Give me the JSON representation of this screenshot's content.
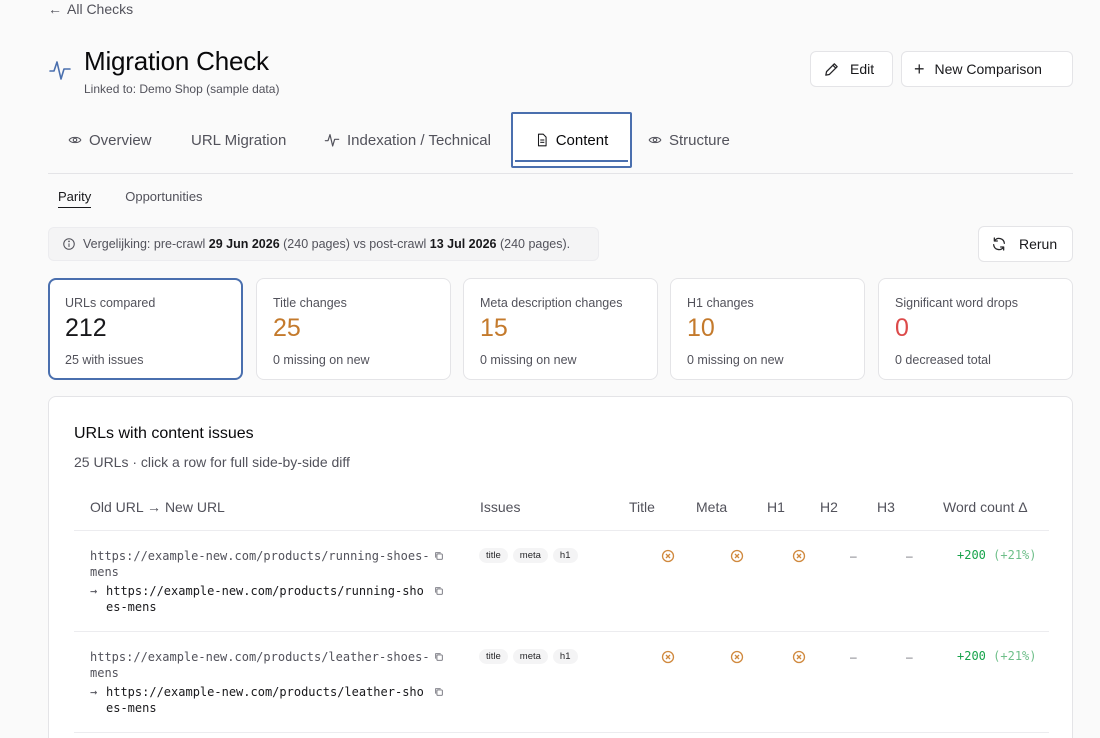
{
  "nav": {
    "back_label": "All Checks"
  },
  "header": {
    "title": "Migration Check",
    "linked": "Linked to: Demo Shop (sample data)",
    "edit_label": "Edit",
    "new_comparison_label": "New Comparison"
  },
  "tabs": [
    {
      "label": "Overview",
      "icon": "eye-icon"
    },
    {
      "label": "URL Migration",
      "icon": ""
    },
    {
      "label": "Indexation / Technical",
      "icon": "activity-icon"
    },
    {
      "label": "Content",
      "icon": "document-icon",
      "active": true
    },
    {
      "label": "Structure",
      "icon": "eye-icon"
    }
  ],
  "subtabs": [
    {
      "label": "Parity",
      "active": true
    },
    {
      "label": "Opportunities"
    }
  ],
  "info": {
    "prefix": "Vergelijking: pre-crawl",
    "pre_date": "29 Jun 2026",
    "pre_pages": "(240 pages) vs post-crawl",
    "post_date": "13 Jul 2026",
    "post_pages": "(240 pages)."
  },
  "rerun_label": "Rerun",
  "cards": [
    {
      "label": "URLs compared",
      "value": "212",
      "note": "25 with issues",
      "color": "#18181b"
    },
    {
      "label": "Title changes",
      "value": "25",
      "note": "0 missing on new",
      "color": "#c47a2c"
    },
    {
      "label": "Meta description changes",
      "value": "15",
      "note": "0 missing on new",
      "color": "#c47a2c"
    },
    {
      "label": "H1 changes",
      "value": "10",
      "note": "0 missing on new",
      "color": "#c47a2c"
    },
    {
      "label": "Significant word drops",
      "value": "0",
      "note": "0 decreased total",
      "color": "#dc4a4a"
    }
  ],
  "panel": {
    "title": "URLs with content issues",
    "subtitle": "25 URLs · click a row for full side-by-side diff"
  },
  "table": {
    "headers": [
      "Old URL → New URL",
      "Issues",
      "Title",
      "Meta",
      "H1",
      "H2",
      "H3",
      "Word count Δ"
    ],
    "rows": [
      {
        "old_url": "https://example-new.com/products/running-shoes-mens",
        "new_url": "https://example-new.com/products/running-shoes-mens",
        "tags": [
          "title",
          "meta",
          "h1"
        ],
        "title": "x",
        "meta": "x",
        "h1": "x",
        "h2": "–",
        "h3": "–",
        "wc_delta": "+200",
        "wc_pct": "(+21%)"
      },
      {
        "old_url": "https://example-new.com/products/leather-shoes-mens",
        "new_url": "https://example-new.com/products/leather-shoes-mens",
        "tags": [
          "title",
          "meta",
          "h1"
        ],
        "title": "x",
        "meta": "x",
        "h1": "x",
        "h2": "–",
        "h3": "–",
        "wc_delta": "+200",
        "wc_pct": "(+21%)"
      }
    ]
  },
  "colors": {
    "accent": "#4a6fae",
    "warning": "#c47a2c",
    "danger": "#dc4a4a",
    "positive": "#16a34a"
  }
}
